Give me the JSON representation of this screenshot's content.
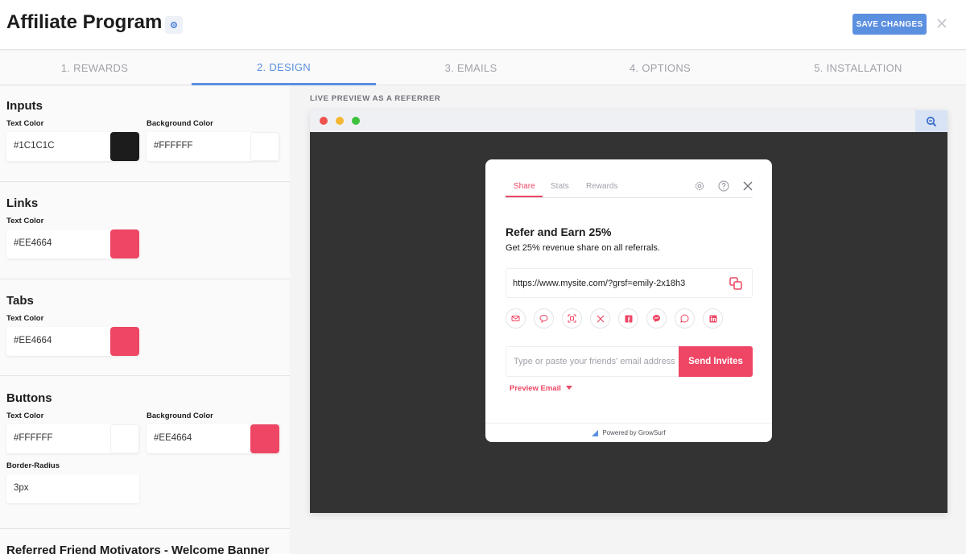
{
  "header": {
    "title": "Affiliate Program",
    "save_label": "SAVE CHANGES"
  },
  "tabs": [
    {
      "label": "1. REWARDS"
    },
    {
      "label": "2. DESIGN"
    },
    {
      "label": "3. EMAILS"
    },
    {
      "label": "4. OPTIONS"
    },
    {
      "label": "5. INSTALLATION"
    }
  ],
  "active_tab": "2. DESIGN",
  "design": {
    "inputs": {
      "title": "Inputs",
      "text_color_label": "Text Color",
      "text_color": "#1C1C1C",
      "bg_color_label": "Background Color",
      "bg_color": "#FFFFFF"
    },
    "links": {
      "title": "Links",
      "text_color_label": "Text Color",
      "text_color": "#EE4664"
    },
    "tabs": {
      "title": "Tabs",
      "text_color_label": "Text Color",
      "text_color": "#EE4664"
    },
    "buttons": {
      "title": "Buttons",
      "text_color_label": "Text Color",
      "text_color": "#FFFFFF",
      "bg_color_label": "Background Color",
      "bg_color": "#EE4664",
      "radius_label": "Border-Radius",
      "radius": "3px"
    },
    "next_section_title": "Referred Friend Motivators - Welcome Banner"
  },
  "preview": {
    "label": "LIVE PREVIEW AS A REFERRER",
    "widget": {
      "tabs": [
        "Share",
        "Stats",
        "Rewards"
      ],
      "heading": "Refer and Earn 25%",
      "subheading": "Get 25% revenue share on all referrals.",
      "share_link": "https://www.mysite.com/?grsf=emily-2x18h3",
      "share_icons": [
        "email-icon",
        "sms-icon",
        "qr-code-icon",
        "x-icon",
        "facebook-icon",
        "messenger-icon",
        "whatsapp-icon",
        "linkedin-icon"
      ],
      "email_placeholder": "Type or paste your friends' email addresses",
      "send_label": "Send Invites",
      "preview_email_label": "Preview Email",
      "footer": "Powered by GrowSurf"
    }
  },
  "colors": {
    "accent": "#5b8fe0",
    "brand": "#ee4664",
    "dark_swatch": "#1c1c1c"
  }
}
